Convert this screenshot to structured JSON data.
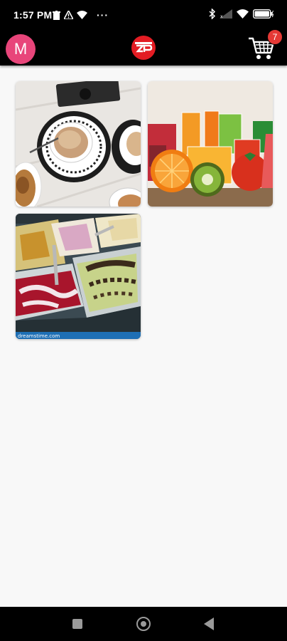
{
  "status_bar": {
    "time": "1:57 PM",
    "more_indicator": "···",
    "icons": [
      "trash-icon",
      "warning-icon",
      "wifi-icon",
      "bluetooth-icon",
      "signal-icon",
      "battery-icon"
    ]
  },
  "app_bar": {
    "avatar_letter": "M",
    "brand_logo_text": "ZP",
    "cart_badge_count": "7"
  },
  "tiles": [
    {
      "subject": "coffee-and-pastries",
      "icon": "coffee-photo"
    },
    {
      "subject": "juices-and-fruit",
      "icon": "juice-photo"
    },
    {
      "subject": "gelato-display",
      "icon": "gelato-photo",
      "watermark": "dreamstime.com"
    }
  ],
  "colors": {
    "bar_background": "#000000",
    "page_background": "#f8f8f8",
    "avatar": "#e8457a",
    "brand": "#e31c23",
    "badge": "#e53935"
  }
}
